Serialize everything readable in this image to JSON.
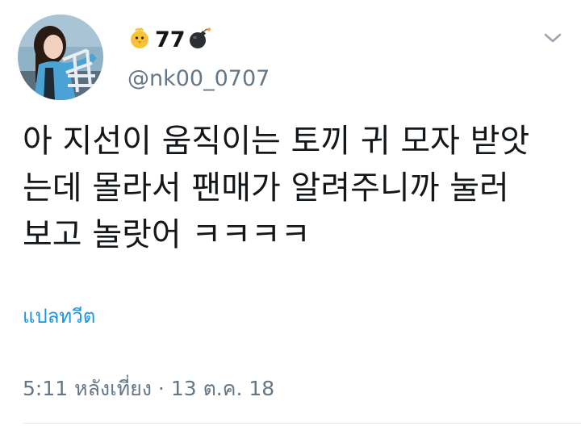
{
  "user": {
    "display_name": "77",
    "handle": "@nk00_0707",
    "name_icons": [
      "chick-icon",
      "bomb-icon"
    ]
  },
  "tweet": {
    "text": "아 지선이 움직이는 토끼 귀 모자 받앗\n는데 몰라서 팬매가 알려주니까 눌러\n보고 놀랏어 ㅋㅋㅋㅋ",
    "translate_label": "แปลทวีต",
    "timestamp": "5:11 หลังเที่ยง · 13 ต.ค. 18"
  },
  "colors": {
    "link": "#1b95e0",
    "secondary_text": "#657786",
    "primary_text": "#14171a"
  },
  "icons": {
    "menu": "chevron-down-icon"
  }
}
